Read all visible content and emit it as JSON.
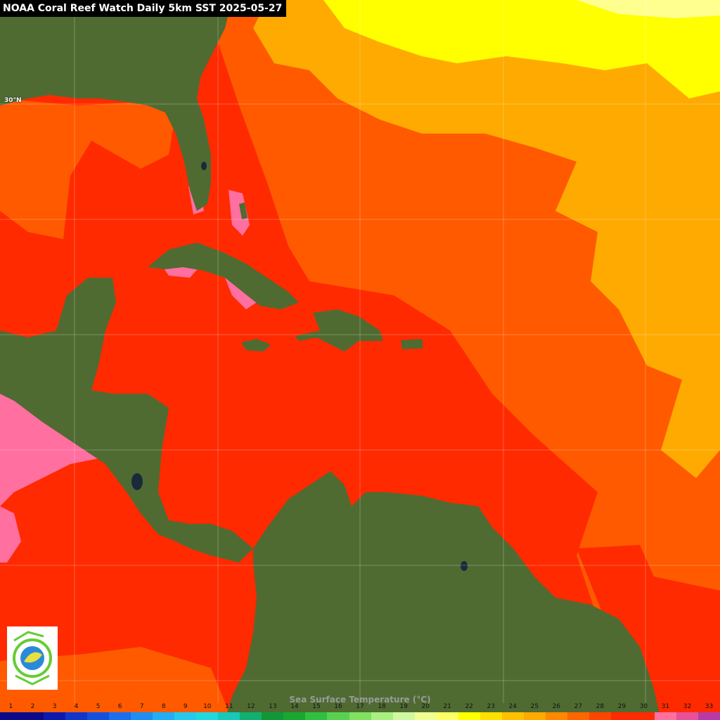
{
  "title": "NOAA Coral Reef Watch Daily 5km SST  2025-05-27",
  "lat_label": "30°N",
  "colorbar": {
    "label": "Sea Surface Temperature (°C)",
    "ticks": [
      "1",
      "2",
      "3",
      "4",
      "5",
      "6",
      "7",
      "8",
      "9",
      "10",
      "11",
      "12",
      "13",
      "14",
      "15",
      "16",
      "17",
      "18",
      "19",
      "20",
      "21",
      "22",
      "23",
      "24",
      "25",
      "26",
      "27",
      "28",
      "29",
      "30",
      "31",
      "32",
      "33"
    ],
    "colors": [
      "#0a0a8a",
      "#0a0a8a",
      "#0d1ab0",
      "#1236cc",
      "#1450e0",
      "#1a6ef0",
      "#1e8ef5",
      "#22aef5",
      "#26c8f0",
      "#22d8e0",
      "#18c8b8",
      "#10b070",
      "#109838",
      "#18a830",
      "#30c040",
      "#5ad050",
      "#80e060",
      "#a8f080",
      "#d0f8a0",
      "#f0ff90",
      "#ffff66",
      "#ffff00",
      "#ffe000",
      "#ffc000",
      "#ffaa00",
      "#ff8800",
      "#ff6600",
      "#ff4400",
      "#ff2a00",
      "#ff2a00",
      "#ff6fa0",
      "#e85098",
      "#b83aa8"
    ]
  },
  "legend_colors": {
    "land": "#4f6b32",
    "sst_31_plus": "#ff6fa0",
    "sst_28_30": "#ff2a00",
    "sst_27": "#ff5a00",
    "sst_26": "#ffaa00",
    "sst_24_25": "#ffff00"
  },
  "logo_icon": "noaa-crw-logo-icon"
}
